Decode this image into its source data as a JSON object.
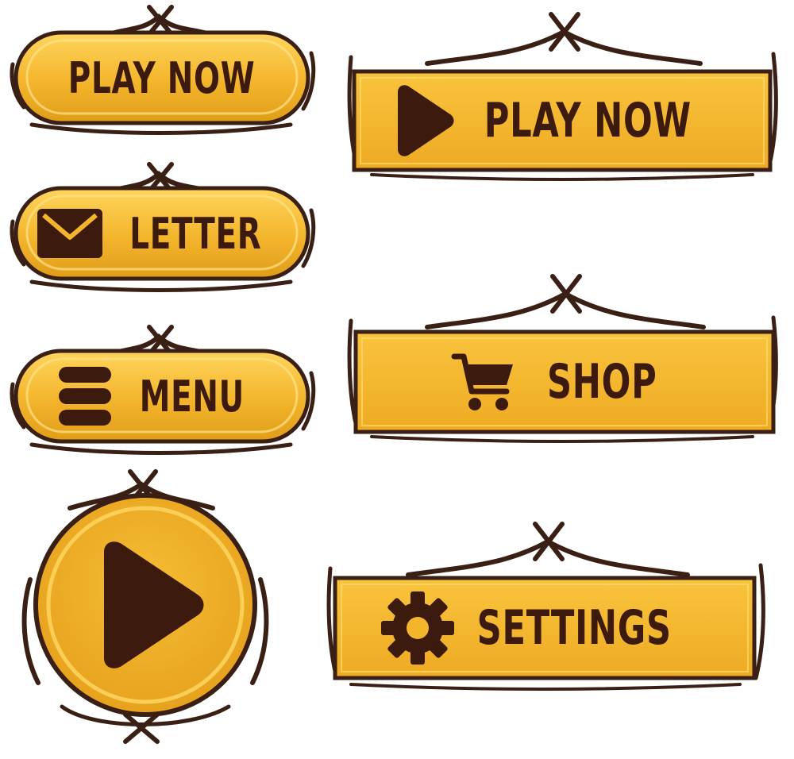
{
  "colors": {
    "gold": "#f2b82f",
    "gold_light": "#ffd257",
    "gold_dark": "#c8850c",
    "brown": "#3d1a0e",
    "vine": "#3a1f14"
  },
  "buttons": {
    "play_pill": {
      "label": "PLAY NOW"
    },
    "letter_pill": {
      "label": "LETTER",
      "icon": "envelope-icon"
    },
    "menu_pill": {
      "label": "MENU",
      "icon": "menu-icon"
    },
    "play_round": {
      "icon": "play-icon"
    },
    "play_plank": {
      "label": "PLAY NOW",
      "icon": "play-icon"
    },
    "shop_plank": {
      "label": "SHOP",
      "icon": "cart-icon"
    },
    "settings_plank": {
      "label": "SETTINGS",
      "icon": "gear-icon"
    }
  }
}
